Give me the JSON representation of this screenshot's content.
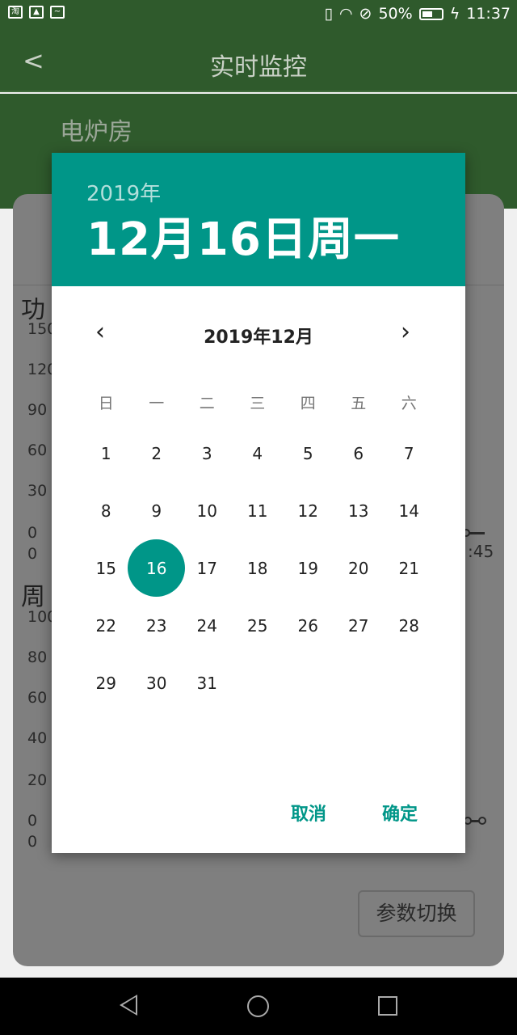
{
  "status_bar": {
    "left_icons": [
      "taobao-icon",
      "image-icon",
      "activity-icon"
    ],
    "battery": "50%",
    "time": "11:37"
  },
  "app": {
    "title": "实时监控",
    "room": "电炉房"
  },
  "background": {
    "heading1": "功",
    "heading2": "周",
    "ticks1": [
      "150",
      "120",
      "90",
      "60",
      "30",
      "0",
      "0"
    ],
    "ticks2": [
      "100",
      "80",
      "60",
      "40",
      "20",
      "0",
      "0"
    ],
    "right_time": ":45",
    "switch_button": "参数切换"
  },
  "dialog": {
    "year": "2019年",
    "date": "12月16日周一",
    "month": "2019年12月",
    "weekdays": [
      "日",
      "一",
      "二",
      "三",
      "四",
      "五",
      "六"
    ],
    "weeks": [
      [
        "1",
        "2",
        "3",
        "4",
        "5",
        "6",
        "7"
      ],
      [
        "8",
        "9",
        "10",
        "11",
        "12",
        "13",
        "14"
      ],
      [
        "15",
        "16",
        "17",
        "18",
        "19",
        "20",
        "21"
      ],
      [
        "22",
        "23",
        "24",
        "25",
        "26",
        "27",
        "28"
      ],
      [
        "29",
        "30",
        "31",
        "",
        "",
        "",
        ""
      ]
    ],
    "selected_day": "16",
    "cancel": "取消",
    "ok": "确定"
  },
  "colors": {
    "accent": "#009688",
    "appbar": "#2f5a2c"
  }
}
